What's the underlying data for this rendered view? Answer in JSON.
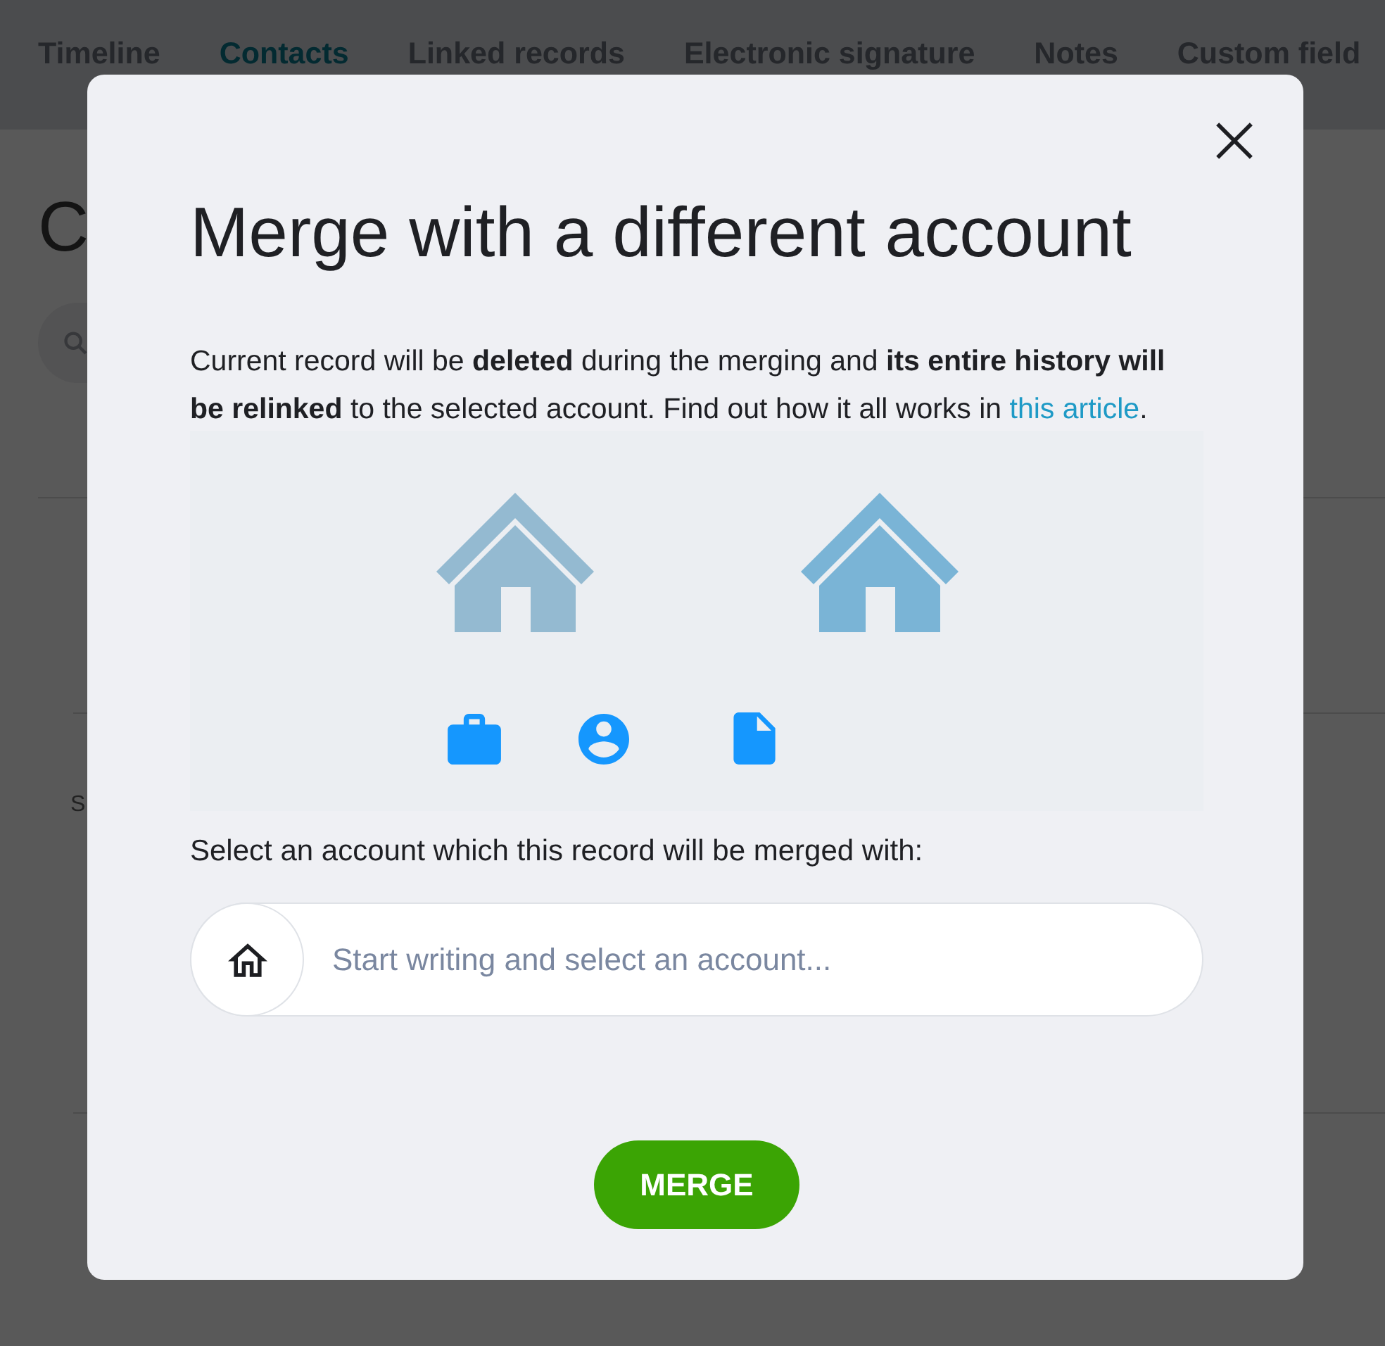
{
  "background_page": {
    "tabs": [
      {
        "label": "Timeline",
        "selected": false
      },
      {
        "label": "Contacts",
        "selected": true
      },
      {
        "label": "Linked records",
        "selected": false
      },
      {
        "label": "Electronic signature",
        "selected": false
      },
      {
        "label": "Notes",
        "selected": false
      },
      {
        "label": "Custom field",
        "selected": false
      }
    ],
    "heading": "C",
    "list_row_text": "S"
  },
  "dialog": {
    "title": "Merge with a different account",
    "description": "Current record will be **deleted** during the merging and **its entire history will be relinked** to the selected account. Find out how it all works in",
    "link": "this article",
    "description_end": ".",
    "account_field": {
      "label": "Select an account which this record will be merged with:",
      "placeholder": "Start writing and select an account..."
    },
    "merge_button": "MERGE"
  }
}
